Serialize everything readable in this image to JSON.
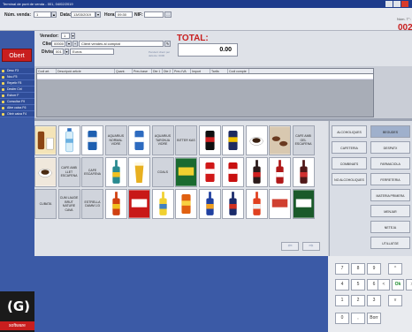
{
  "window": {
    "title": "Terminal de punt de venda - 001, 04/02/2019"
  },
  "header": {
    "num_venda_label": "Núm. venda:",
    "num_venda_value": "1",
    "date_label": "Data:",
    "date_value": "13/03/2019",
    "hour_label": "Hora:",
    "hour_value": "09:30",
    "nif_label": "NIF:",
    "venedor_label": "Venedor:",
    "venedor_value": "1",
    "client_label": "Client:",
    "client_code": "00000",
    "client_name": "Client vendes al comptat",
    "divisa_label": "Divisa:",
    "divisa_code": "001",
    "divisa_name": "Euros"
  },
  "total": {
    "label": "TOTAL:",
    "value": "0.00",
    "pending": "Pendent client per defecte: 0000"
  },
  "ticket": {
    "label": "Núm. T°:",
    "number": "002"
  },
  "left": {
    "obert_label": "Obert",
    "items": [
      "Desc F3",
      "Nou F5",
      "Repetir F8",
      "Desfer Ctrl",
      "Esborr F",
      "Consultar F9",
      "Altre caixa F6",
      "Obrir caixa F4"
    ],
    "logo_text": "software"
  },
  "grid": {
    "columns": [
      "Codi art.",
      "Descripció article",
      "Quant.",
      "Preu base",
      "Dte 1",
      "Dte 2",
      "Preu IVA",
      "Import",
      "Tarifa",
      "Codi compte"
    ]
  },
  "products": [
    {
      "row": 0,
      "col": 0,
      "kind": "image",
      "icon": "bottle-cup",
      "fill": "#f4e4b8",
      "accent": "#8b4513"
    },
    {
      "row": 0,
      "col": 1,
      "kind": "image",
      "icon": "water-bottle",
      "fill": "#ffffff",
      "accent": "#6ab0e0"
    },
    {
      "row": 0,
      "col": 2,
      "kind": "image",
      "icon": "can",
      "fill": "#1e5fb0",
      "accent": "#f0f0f0"
    },
    {
      "row": 0,
      "col": 3,
      "kind": "text",
      "label": "AQUARIUS NORMAL VIDRE"
    },
    {
      "row": 0,
      "col": 4,
      "kind": "image",
      "icon": "can",
      "fill": "#2d6bc0",
      "accent": "#ffffff"
    },
    {
      "row": 0,
      "col": 5,
      "kind": "text",
      "label": "AQUARIUS TARONJA VIDRE"
    },
    {
      "row": 0,
      "col": 6,
      "kind": "text",
      "label": "BITTER KAS"
    },
    {
      "row": 0,
      "col": 7,
      "kind": "image",
      "icon": "can",
      "fill": "#101010",
      "accent": "#d02020"
    },
    {
      "row": 0,
      "col": 8,
      "kind": "image",
      "icon": "can",
      "fill": "#1e2a60",
      "accent": "#f0c000"
    },
    {
      "row": 0,
      "col": 9,
      "kind": "image",
      "icon": "coffee-cup",
      "fill": "#ffffff",
      "accent": "#3a2010"
    },
    {
      "row": 0,
      "col": 10,
      "kind": "image",
      "icon": "coffee-cups",
      "fill": "#d8c8b0",
      "accent": "#6a3a20"
    },
    {
      "row": 0,
      "col": 11,
      "kind": "text",
      "label": "CAFE AMB GEL ESCAFENA"
    },
    {
      "row": 1,
      "col": 0,
      "kind": "image",
      "icon": "coffee-cup",
      "fill": "#f0e8dc",
      "accent": "#4a2a10"
    },
    {
      "row": 1,
      "col": 1,
      "kind": "text",
      "label": "CAFE AMB LLET ESCAFENA"
    },
    {
      "row": 1,
      "col": 2,
      "kind": "text",
      "label": "CAFE ESCAFENA"
    },
    {
      "row": 1,
      "col": 3,
      "kind": "image",
      "icon": "bottle",
      "fill": "#2a8a90",
      "accent": "#f0c020"
    },
    {
      "row": 1,
      "col": 4,
      "kind": "image",
      "icon": "beer-glass",
      "fill": "#ffffff",
      "accent": "#e8b020"
    },
    {
      "row": 1,
      "col": 5,
      "kind": "text",
      "label": "COALS"
    },
    {
      "row": 1,
      "col": 6,
      "kind": "image",
      "icon": "label",
      "fill": "#1a6a30",
      "accent": "#f0d030"
    },
    {
      "row": 1,
      "col": 7,
      "kind": "image",
      "icon": "can",
      "fill": "#d01818",
      "accent": "#ffffff"
    },
    {
      "row": 1,
      "col": 8,
      "kind": "image",
      "icon": "can",
      "fill": "#c81010",
      "accent": "#ffffff"
    },
    {
      "row": 1,
      "col": 9,
      "kind": "image",
      "icon": "bottle",
      "fill": "#2a1a1a",
      "accent": "#d02020"
    },
    {
      "row": 1,
      "col": 10,
      "kind": "image",
      "icon": "bottle",
      "fill": "#b01818",
      "accent": "#ffffff"
    },
    {
      "row": 1,
      "col": 11,
      "kind": "image",
      "icon": "bottle",
      "fill": "#501818",
      "accent": "#d03030"
    },
    {
      "row": 2,
      "col": 0,
      "kind": "text",
      "label": "CUBATA"
    },
    {
      "row": 2,
      "col": 1,
      "kind": "text",
      "label": "CUM LAUDE BRUT NATURE CAVA"
    },
    {
      "row": 2,
      "col": 2,
      "kind": "text",
      "label": "ESTRELLA DAMM 1/3"
    },
    {
      "row": 2,
      "col": 3,
      "kind": "image",
      "icon": "bottle",
      "fill": "#d04010",
      "accent": "#f0c020"
    },
    {
      "row": 2,
      "col": 4,
      "kind": "image",
      "icon": "label",
      "fill": "#c81818",
      "accent": "#ffffff"
    },
    {
      "row": 2,
      "col": 5,
      "kind": "image",
      "icon": "bottle",
      "fill": "#f0d030",
      "accent": "#4080c0"
    },
    {
      "row": 2,
      "col": 6,
      "kind": "image",
      "icon": "can",
      "fill": "#e06010",
      "accent": "#f8d040"
    },
    {
      "row": 2,
      "col": 7,
      "kind": "image",
      "icon": "bottle",
      "fill": "#2040a0",
      "accent": "#f0a020"
    },
    {
      "row": 2,
      "col": 8,
      "kind": "image",
      "icon": "bottle",
      "fill": "#1a2a6a",
      "accent": "#d03020"
    },
    {
      "row": 2,
      "col": 9,
      "kind": "image",
      "icon": "bottle",
      "fill": "#e04020",
      "accent": "#f0f0f0"
    },
    {
      "row": 2,
      "col": 10,
      "kind": "image",
      "icon": "label",
      "fill": "#ffffff",
      "accent": "#d04030"
    },
    {
      "row": 2,
      "col": 11,
      "kind": "image",
      "icon": "label",
      "fill": "#1a5a2a",
      "accent": "#ffffff"
    }
  ],
  "categories_left": [
    "ALCOHOLIQUES",
    "CAFETERIA",
    "COMBINATS",
    "NO ALCOHOLIQUES"
  ],
  "categories_right": [
    "BEGUDES",
    "DESPATX",
    "FARMACIOLA",
    "FERRETERIA",
    "MATERIA PRIMERA",
    "MENJAR",
    "NETEJA",
    "UTILLATGE"
  ],
  "active_category": "BEGUDES",
  "keypad": {
    "keys": [
      "7",
      "8",
      "9",
      "^",
      "4",
      "5",
      "6",
      "<",
      "Ok",
      ">",
      "1",
      "2",
      "3",
      "v",
      "0",
      ",",
      "Borr"
    ]
  },
  "colors": {
    "brand_red": "#c81e1e",
    "panel_blue": "#3b5aa6",
    "title_blue": "#1e3c8c"
  }
}
